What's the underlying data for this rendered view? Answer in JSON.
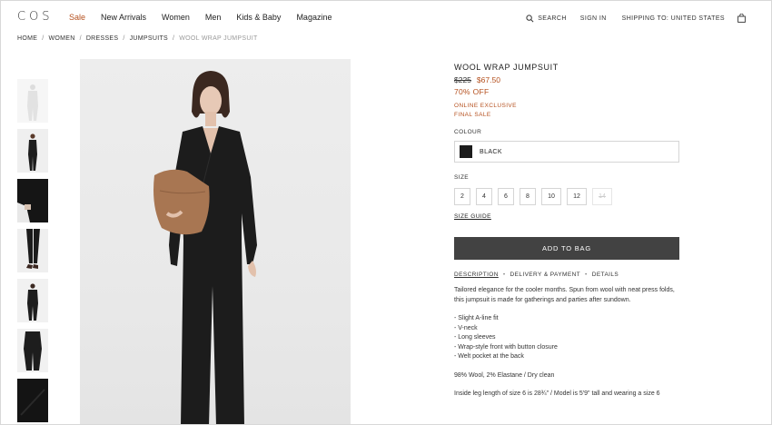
{
  "header": {
    "logo": "COS",
    "nav": [
      "Sale",
      "New Arrivals",
      "Women",
      "Men",
      "Kids & Baby",
      "Magazine"
    ],
    "search": "SEARCH",
    "sign_in": "SIGN IN",
    "shipping": "SHIPPING TO: UNITED STATES"
  },
  "breadcrumb": [
    "HOME",
    "WOMEN",
    "DRESSES",
    "JUMPSUITS",
    "WOOL WRAP JUMPSUIT"
  ],
  "product": {
    "title": "WOOL WRAP JUMPSUIT",
    "old_price": "$225",
    "new_price": "$67.50",
    "discount": "70% OFF",
    "tag_online": "ONLINE EXCLUSIVE",
    "tag_final": "FINAL SALE",
    "colour_label": "COLOUR",
    "colour_value": "BLACK",
    "size_label": "SIZE",
    "sizes": [
      "2",
      "4",
      "6",
      "8",
      "10",
      "12",
      "14"
    ],
    "size_guide": "SIZE GUIDE",
    "add_to_bag": "ADD TO BAG",
    "tabs": [
      "DESCRIPTION",
      "DELIVERY & PAYMENT",
      "DETAILS"
    ],
    "description": "Tailored elegance for the cooler months. Spun from wool with neat press folds, this jumpsuit is made for gatherings and parties after sundown.",
    "bullets": [
      "- Slight A-line fit",
      "- V-neck",
      "- Long sleeves",
      "- Wrap-style front with button closure",
      "- Welt pocket at the back"
    ],
    "material": "98% Wool, 2% Elastane / Dry clean",
    "fit_note": "Inside leg length of size 6 is 28¾\" / Model is 5'9\" tall and wearing a size 6"
  },
  "colors": {
    "sale": "#b5501e",
    "button": "#424242",
    "swatch": "#1c1c1c"
  }
}
